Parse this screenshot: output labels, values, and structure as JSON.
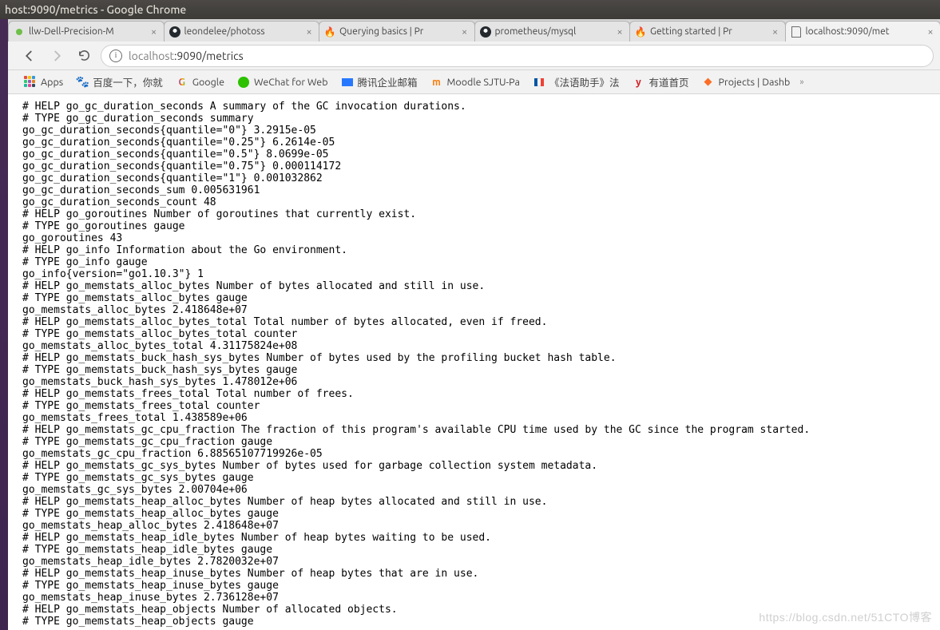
{
  "window": {
    "title": "host:9090/metrics - Google Chrome"
  },
  "tabs": [
    {
      "title": "llw-Dell-Precision-M",
      "icon": "green-dot"
    },
    {
      "title": "leondelee/photoss",
      "icon": "github"
    },
    {
      "title": "Querying basics | Pr",
      "icon": "prom"
    },
    {
      "title": "prometheus/mysql",
      "icon": "github"
    },
    {
      "title": "Getting started | Pr",
      "icon": "prom"
    },
    {
      "title": "localhost:9090/met",
      "icon": "page",
      "active": true
    }
  ],
  "omnibox": {
    "host": "localhost",
    "port_path": ":9090/metrics"
  },
  "bookmarks": [
    {
      "label": "Apps",
      "kind": "apps"
    },
    {
      "label": "百度一下，你就",
      "kind": "baidu"
    },
    {
      "label": "Google",
      "kind": "google"
    },
    {
      "label": "WeChat for Web",
      "kind": "wechat"
    },
    {
      "label": "腾讯企业邮箱",
      "kind": "qqmail"
    },
    {
      "label": "Moodle SJTU-Pa",
      "kind": "moodle"
    },
    {
      "label": "《法语助手》法",
      "kind": "fr"
    },
    {
      "label": "有道首页",
      "kind": "youdao"
    },
    {
      "label": "Projects | Dashb",
      "kind": "gitlab"
    }
  ],
  "metrics_lines": [
    "# HELP go_gc_duration_seconds A summary of the GC invocation durations.",
    "# TYPE go_gc_duration_seconds summary",
    "go_gc_duration_seconds{quantile=\"0\"} 3.2915e-05",
    "go_gc_duration_seconds{quantile=\"0.25\"} 6.2614e-05",
    "go_gc_duration_seconds{quantile=\"0.5\"} 8.0699e-05",
    "go_gc_duration_seconds{quantile=\"0.75\"} 0.000114172",
    "go_gc_duration_seconds{quantile=\"1\"} 0.001032862",
    "go_gc_duration_seconds_sum 0.005631961",
    "go_gc_duration_seconds_count 48",
    "# HELP go_goroutines Number of goroutines that currently exist.",
    "# TYPE go_goroutines gauge",
    "go_goroutines 43",
    "# HELP go_info Information about the Go environment.",
    "# TYPE go_info gauge",
    "go_info{version=\"go1.10.3\"} 1",
    "# HELP go_memstats_alloc_bytes Number of bytes allocated and still in use.",
    "# TYPE go_memstats_alloc_bytes gauge",
    "go_memstats_alloc_bytes 2.418648e+07",
    "# HELP go_memstats_alloc_bytes_total Total number of bytes allocated, even if freed.",
    "# TYPE go_memstats_alloc_bytes_total counter",
    "go_memstats_alloc_bytes_total 4.31175824e+08",
    "# HELP go_memstats_buck_hash_sys_bytes Number of bytes used by the profiling bucket hash table.",
    "# TYPE go_memstats_buck_hash_sys_bytes gauge",
    "go_memstats_buck_hash_sys_bytes 1.478012e+06",
    "# HELP go_memstats_frees_total Total number of frees.",
    "# TYPE go_memstats_frees_total counter",
    "go_memstats_frees_total 1.438589e+06",
    "# HELP go_memstats_gc_cpu_fraction The fraction of this program's available CPU time used by the GC since the program started.",
    "# TYPE go_memstats_gc_cpu_fraction gauge",
    "go_memstats_gc_cpu_fraction 6.88565107719926e-05",
    "# HELP go_memstats_gc_sys_bytes Number of bytes used for garbage collection system metadata.",
    "# TYPE go_memstats_gc_sys_bytes gauge",
    "go_memstats_gc_sys_bytes 2.00704e+06",
    "# HELP go_memstats_heap_alloc_bytes Number of heap bytes allocated and still in use.",
    "# TYPE go_memstats_heap_alloc_bytes gauge",
    "go_memstats_heap_alloc_bytes 2.418648e+07",
    "# HELP go_memstats_heap_idle_bytes Number of heap bytes waiting to be used.",
    "# TYPE go_memstats_heap_idle_bytes gauge",
    "go_memstats_heap_idle_bytes 2.7820032e+07",
    "# HELP go_memstats_heap_inuse_bytes Number of heap bytes that are in use.",
    "# TYPE go_memstats_heap_inuse_bytes gauge",
    "go_memstats_heap_inuse_bytes 2.736128e+07",
    "# HELP go_memstats_heap_objects Number of allocated objects.",
    "# TYPE go_memstats_heap_objects gauge"
  ],
  "watermark": "https://blog.csdn.net/51CTO博客"
}
